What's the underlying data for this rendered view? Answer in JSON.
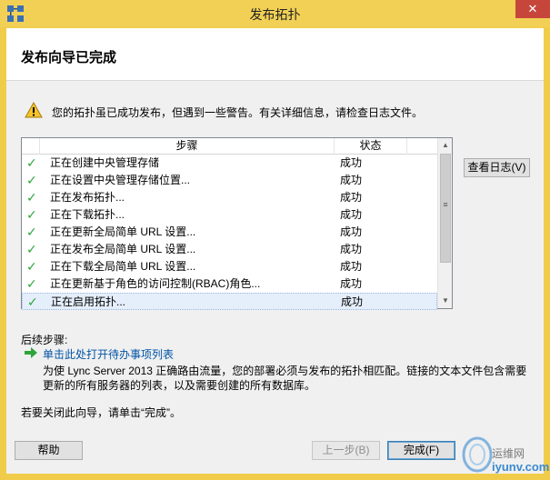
{
  "window": {
    "title": "发布拓扑",
    "close_glyph": "✕"
  },
  "header": {
    "title": "发布向导已完成"
  },
  "warning": {
    "icon": "warning-triangle-icon",
    "text": "您的拓扑虽已成功发布，但遇到一些警告。有关详细信息，请检查日志文件。"
  },
  "list": {
    "columns": {
      "step": "步骤",
      "status": "状态"
    },
    "rows": [
      {
        "step": "正在创建中央管理存储",
        "status": "成功"
      },
      {
        "step": "正在设置中央管理存储位置...",
        "status": "成功"
      },
      {
        "step": "正在发布拓扑...",
        "status": "成功"
      },
      {
        "step": "正在下载拓扑...",
        "status": "成功"
      },
      {
        "step": "正在更新全局简单 URL 设置...",
        "status": "成功"
      },
      {
        "step": "正在发布全局简单 URL 设置...",
        "status": "成功"
      },
      {
        "step": "正在下载全局简单 URL 设置...",
        "status": "成功"
      },
      {
        "step": "正在更新基于角色的访问控制(RBAC)角色...",
        "status": "成功"
      },
      {
        "step": "正在启用拓扑...",
        "status": "成功"
      }
    ],
    "check_glyph": "✓",
    "scroll_up_glyph": "▲",
    "scroll_down_glyph": "▼",
    "scroll_grip_glyph": "≡"
  },
  "buttons": {
    "view_log": "查看日志(V)",
    "help": "帮助",
    "back": "上一步(B)",
    "finish": "完成(F)"
  },
  "next_steps": {
    "label": "后续步骤:",
    "link": "单击此处打开待办事项列表",
    "description": "为使 Lync Server 2013 正确路由流量，您的部署必须与发布的拓扑相匹配。链接的文本文件包含需要更新的所有服务器的列表，以及需要创建的所有数据库。"
  },
  "close_hint": "若要关闭此向导，请单击“完成”。",
  "watermark": {
    "line1": "运维网",
    "line2": "iyunv.com"
  },
  "colors": {
    "title_bar": "#f2d055",
    "close_button": "#c7463b",
    "link": "#0053a6",
    "check": "#2ea53a"
  }
}
